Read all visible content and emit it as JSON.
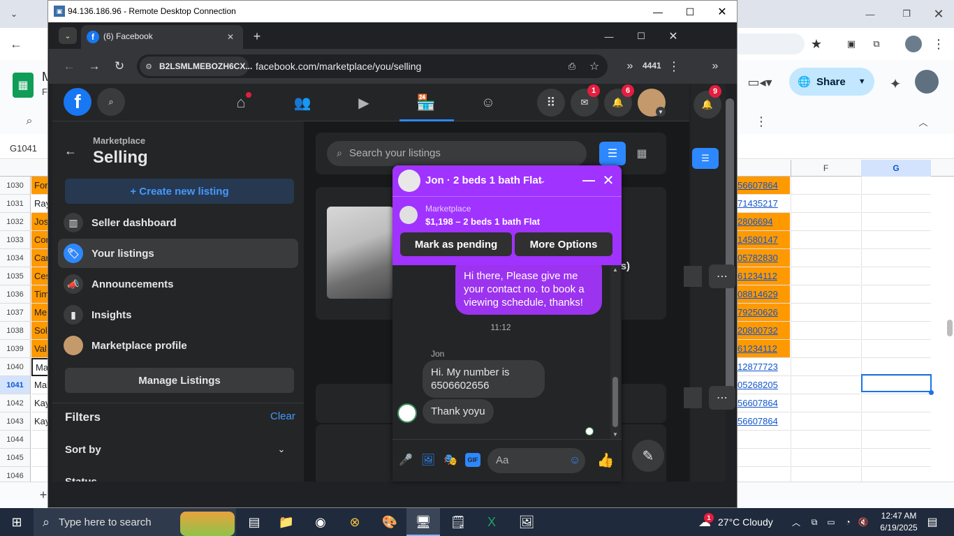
{
  "host": {
    "sheets": {
      "title_fragment_1": "M",
      "title_fragment_2": "F",
      "share_label": "Share",
      "cell_ref": "G1041",
      "col_f": "F",
      "col_g": "G",
      "rows": [
        {
          "num": "1030",
          "left": "For",
          "e": "56607864",
          "orange": true
        },
        {
          "num": "1031",
          "left": "Ray",
          "e": "71435217",
          "orange": false
        },
        {
          "num": "1032",
          "left": "Jos",
          "e": "2806694",
          "orange": true
        },
        {
          "num": "1033",
          "left": "Cor",
          "e": "14580147",
          "orange": true
        },
        {
          "num": "1034",
          "left": "Car",
          "e": "05782830",
          "orange": true
        },
        {
          "num": "1035",
          "left": "Ces",
          "e": "61234112",
          "orange": true
        },
        {
          "num": "1036",
          "left": "Tim",
          "e": "08814629",
          "orange": true
        },
        {
          "num": "1037",
          "left": "Me",
          "e": "79250626",
          "orange": true
        },
        {
          "num": "1038",
          "left": "Sol",
          "e": "20800732",
          "orange": true
        },
        {
          "num": "1039",
          "left": "Val",
          "e": "61234112",
          "orange": true
        },
        {
          "num": "1040",
          "left": "Ma",
          "e": "12877723",
          "orange": false
        },
        {
          "num": "1041",
          "left": "Mal",
          "e": "05268205",
          "orange": false
        },
        {
          "num": "1042",
          "left": "Kay",
          "e": "56607864",
          "orange": false
        },
        {
          "num": "1043",
          "left": "Kay",
          "e": "56607864",
          "orange": false
        },
        {
          "num": "1044",
          "left": "",
          "e": "",
          "orange": false
        },
        {
          "num": "1045",
          "left": "",
          "e": "",
          "orange": false
        },
        {
          "num": "1046",
          "left": "",
          "e": "",
          "orange": false
        }
      ]
    }
  },
  "rdp": {
    "title": "94.136.186.96 - Remote Desktop Connection"
  },
  "browser": {
    "tab_title": "(6) Facebook",
    "site_chip": "B2LSMLMEBOZH6CX...",
    "url": "facebook.com/marketplace/you/selling",
    "ext_count": "4441"
  },
  "facebook": {
    "badges": {
      "messenger": "1",
      "notifications": "6",
      "host_notifications": "9"
    },
    "sidebar": {
      "crumb": "Marketplace",
      "heading": "Selling",
      "create_label": "+ Create new listing",
      "items": [
        {
          "label": "Seller dashboard",
          "icon": "dashboard-icon"
        },
        {
          "label": "Your listings",
          "icon": "tag-icon"
        },
        {
          "label": "Announcements",
          "icon": "megaphone-icon"
        },
        {
          "label": "Insights",
          "icon": "chart-icon"
        },
        {
          "label": "Marketplace profile",
          "icon": "profile-avatar"
        }
      ],
      "manage_label": "Manage Listings",
      "filters_label": "Filters",
      "clear_label": "Clear",
      "sort_label": "Sort by",
      "status_label": "Status"
    },
    "main": {
      "search_placeholder": "Search your listings",
      "listing_fragment": "ays)"
    },
    "chat": {
      "title": "Jon · 2 beds 1 bath Flat",
      "context_source": "Marketplace",
      "context_listing": "$1,198 – 2 beds 1 bath Flat",
      "mark_pending": "Mark as pending",
      "more_options": "More Options",
      "msg_sent": "Hi there, Please give me your contact no. to book a viewing schedule, thanks!",
      "time": "11:12",
      "sender_name": "Jon",
      "msg_reply_1": "Hi. My number is 6506602656",
      "msg_reply_2": "Thank yoyu",
      "input_placeholder": "Aa"
    }
  },
  "taskbar": {
    "search_placeholder": "Type here to search",
    "weather": "27°C  Cloudy",
    "weather_badge": "1",
    "time": "12:47 AM",
    "date": "6/19/2025"
  }
}
